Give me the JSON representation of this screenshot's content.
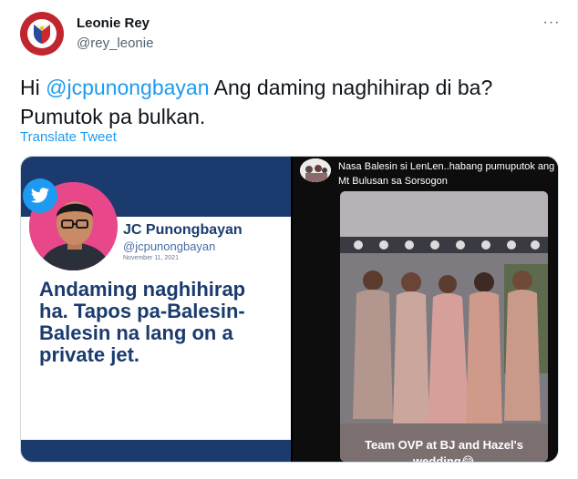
{
  "author": {
    "name": "Leonie Rey",
    "handle": "@rey_leonie"
  },
  "tweet": {
    "text_pre": "Hi ",
    "mention": "@jcpunongbayan",
    "text_post": " Ang daming naghihirap di ba? Pumutok pa bulkan.",
    "translate_label": "Translate Tweet",
    "more_label": "···"
  },
  "media": {
    "left": {
      "name": "JC Punongbayan",
      "handle": "@jcpunongbayan",
      "date": "November 11, 2021",
      "quote": "Andaming naghihirap ha. Tapos pa-Balesin-Balesin na lang on a private jet."
    },
    "right": {
      "story_caption": "Nasa Balesin si LenLen..habang pumuputok ang Mt Bulusan sa Sorsogon",
      "photo_caption": "Team OVP at BJ and Hazel's wedding😂"
    }
  },
  "colors": {
    "accent": "#1d9bf0",
    "left_banner": "#1b3b6e",
    "avatar_red": "#c0262d"
  }
}
